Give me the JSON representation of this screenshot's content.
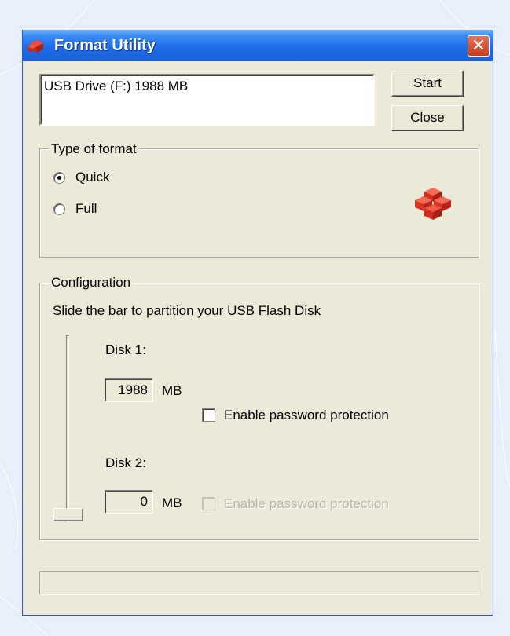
{
  "window": {
    "title": "Format Utility",
    "title_color": "#1f6ce8",
    "close_icon": "close-x"
  },
  "drive": {
    "selected": "USB Drive  (F:) 1988 MB"
  },
  "buttons": {
    "start": "Start",
    "close": "Close"
  },
  "format_type": {
    "legend": "Type of format",
    "options": [
      {
        "label": "Quick",
        "selected": true
      },
      {
        "label": "Full",
        "selected": false
      }
    ],
    "logo_icon": "red-blocks-logo"
  },
  "configuration": {
    "legend": "Configuration",
    "instruction": "Slide the bar to partition your USB Flash Disk",
    "disk1": {
      "label": "Disk 1:",
      "size": "1988",
      "unit": "MB",
      "password_label": "Enable password protection",
      "password_enabled": true,
      "password_checked": false
    },
    "disk2": {
      "label": "Disk 2:",
      "size": "0",
      "unit": "MB",
      "password_label": "Enable password protection",
      "password_enabled": false,
      "password_checked": false
    },
    "slider_disk2_fraction": 0
  },
  "status": {
    "text": ""
  }
}
